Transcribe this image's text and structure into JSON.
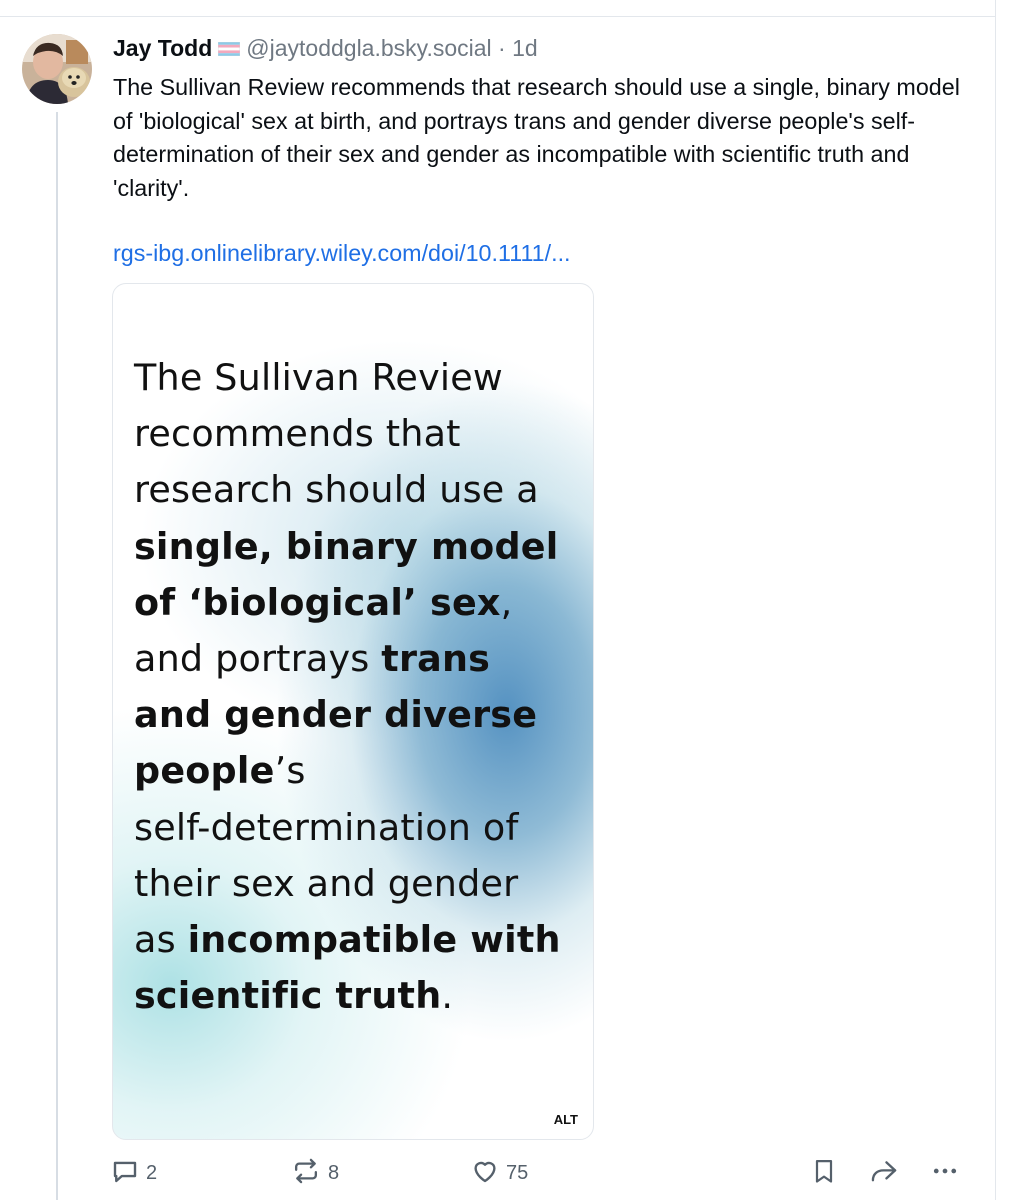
{
  "post": {
    "author_name": "Jay Todd",
    "author_handle": "@jaytoddgla.bsky.social",
    "separator": "·",
    "timestamp": "1d",
    "text": "The Sullivan Review recommends that research should use a single, binary model of 'biological' sex at birth, and portrays trans and gender diverse people's self-determination of their sex and gender as incompatible with scientific truth and 'clarity'.",
    "link_text": "rgs-ibg.onlinelibrary.wiley.com/doi/10.1111/..."
  },
  "media": {
    "lines": [
      {
        "parts": [
          {
            "t": "The Sullivan Review"
          }
        ]
      },
      {
        "parts": [
          {
            "t": "recommends that"
          }
        ]
      },
      {
        "parts": [
          {
            "t": "research should use a"
          }
        ]
      },
      {
        "parts": [
          {
            "t": "single, binary model",
            "b": true
          }
        ]
      },
      {
        "parts": [
          {
            "t": "of ‘biological’ sex",
            "b": true
          },
          {
            "t": ","
          }
        ]
      },
      {
        "parts": [
          {
            "t": "and portrays "
          },
          {
            "t": "trans",
            "b": true
          }
        ]
      },
      {
        "parts": [
          {
            "t": "and gender diverse",
            "b": true
          }
        ]
      },
      {
        "parts": [
          {
            "t": "people",
            "b": true
          },
          {
            "t": "’s"
          }
        ]
      },
      {
        "parts": [
          {
            "t": "self-determination of"
          }
        ]
      },
      {
        "parts": [
          {
            "t": "their sex and gender"
          }
        ]
      },
      {
        "parts": [
          {
            "t": "as "
          },
          {
            "t": "incompatible with",
            "b": true
          }
        ]
      },
      {
        "parts": [
          {
            "t": "scientific truth",
            "b": true
          },
          {
            "t": "."
          }
        ]
      }
    ],
    "alt_label": "ALT"
  },
  "actions": {
    "reply_count": "2",
    "repost_count": "8",
    "like_count": "75"
  },
  "icons": {
    "reply": "speech-bubble-icon",
    "repost": "repost-arrows-icon",
    "like": "heart-icon",
    "bookmark": "bookmark-icon",
    "share": "share-arrow-icon",
    "more": "ellipsis-icon",
    "flag": "transgender-flag-icon"
  },
  "colors": {
    "link": "#1f6fe5",
    "muted": "#6f7882",
    "text": "#0b0f14"
  }
}
